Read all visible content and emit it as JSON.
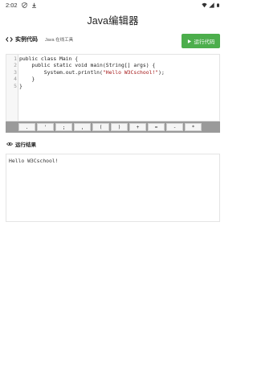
{
  "status_bar": {
    "time": "2:02",
    "icons": [
      "shield-icon",
      "download-icon",
      "wifi-icon",
      "signal-icon",
      "battery-icon"
    ]
  },
  "app_title": "Java编辑器",
  "code_section": {
    "icon": "code-icon",
    "title": "实例代码",
    "subtitle": "Java 在线工具",
    "run_label": "运行代码"
  },
  "editor": {
    "lines": [
      {
        "no": "1",
        "code": "public class Main {"
      },
      {
        "no": "2",
        "code": "    public static void main(String[] args) {"
      },
      {
        "no": "3",
        "code_before": "        System.out.println(",
        "string": "\"Hello W3Cschool!\"",
        "code_after": ");"
      },
      {
        "no": "4",
        "code": "    }"
      },
      {
        "no": "5",
        "code": "}"
      }
    ]
  },
  "symbol_keys": [
    ".",
    "'",
    ";",
    ",",
    "(",
    ")",
    "+",
    "=",
    "-",
    "*"
  ],
  "result_section": {
    "icon": "eye-icon",
    "title": "运行结果"
  },
  "output": {
    "text": "Hello W3Cschool!"
  },
  "colors": {
    "run_button": "#4cae4c",
    "symbol_bar": "#9a9a9a"
  }
}
